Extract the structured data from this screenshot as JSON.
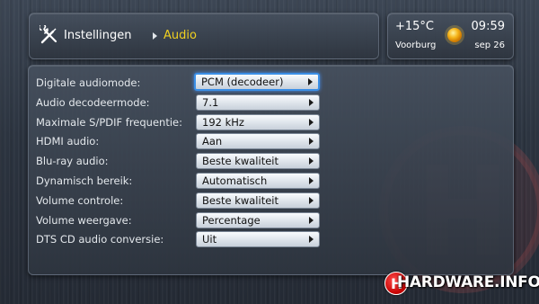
{
  "header": {
    "breadcrumb_root": "Instellingen",
    "breadcrumb_current": "Audio",
    "tools_icon": "tools-icon",
    "accent_color": "#f0d020"
  },
  "weather": {
    "temperature": "+15°C",
    "time": "09:59",
    "city": "Voorburg",
    "date": "sep 26",
    "icon": "sun-icon"
  },
  "settings": {
    "rows": [
      {
        "label": "Digitale audiomode:",
        "value": "PCM (decodeer)",
        "focused": true
      },
      {
        "label": "Audio decodeermode:",
        "value": "7.1"
      },
      {
        "label": "Maximale S/PDIF frequentie:",
        "value": "192 kHz"
      },
      {
        "label": "HDMI audio:",
        "value": "Aan"
      },
      {
        "label": "Blu-ray audio:",
        "value": "Beste kwaliteit"
      },
      {
        "label": "Dynamisch bereik:",
        "value": "Automatisch"
      },
      {
        "label": "Volume controle:",
        "value": "Beste kwaliteit"
      },
      {
        "label": "Volume weergave:",
        "value": "Percentage"
      },
      {
        "label": "DTS CD audio conversie:",
        "value": "Uit"
      }
    ],
    "focus_color": "#3b8fe6"
  },
  "watermark": {
    "logo_text": "HARDWARE.INFO",
    "logo_color": "#c40000"
  }
}
